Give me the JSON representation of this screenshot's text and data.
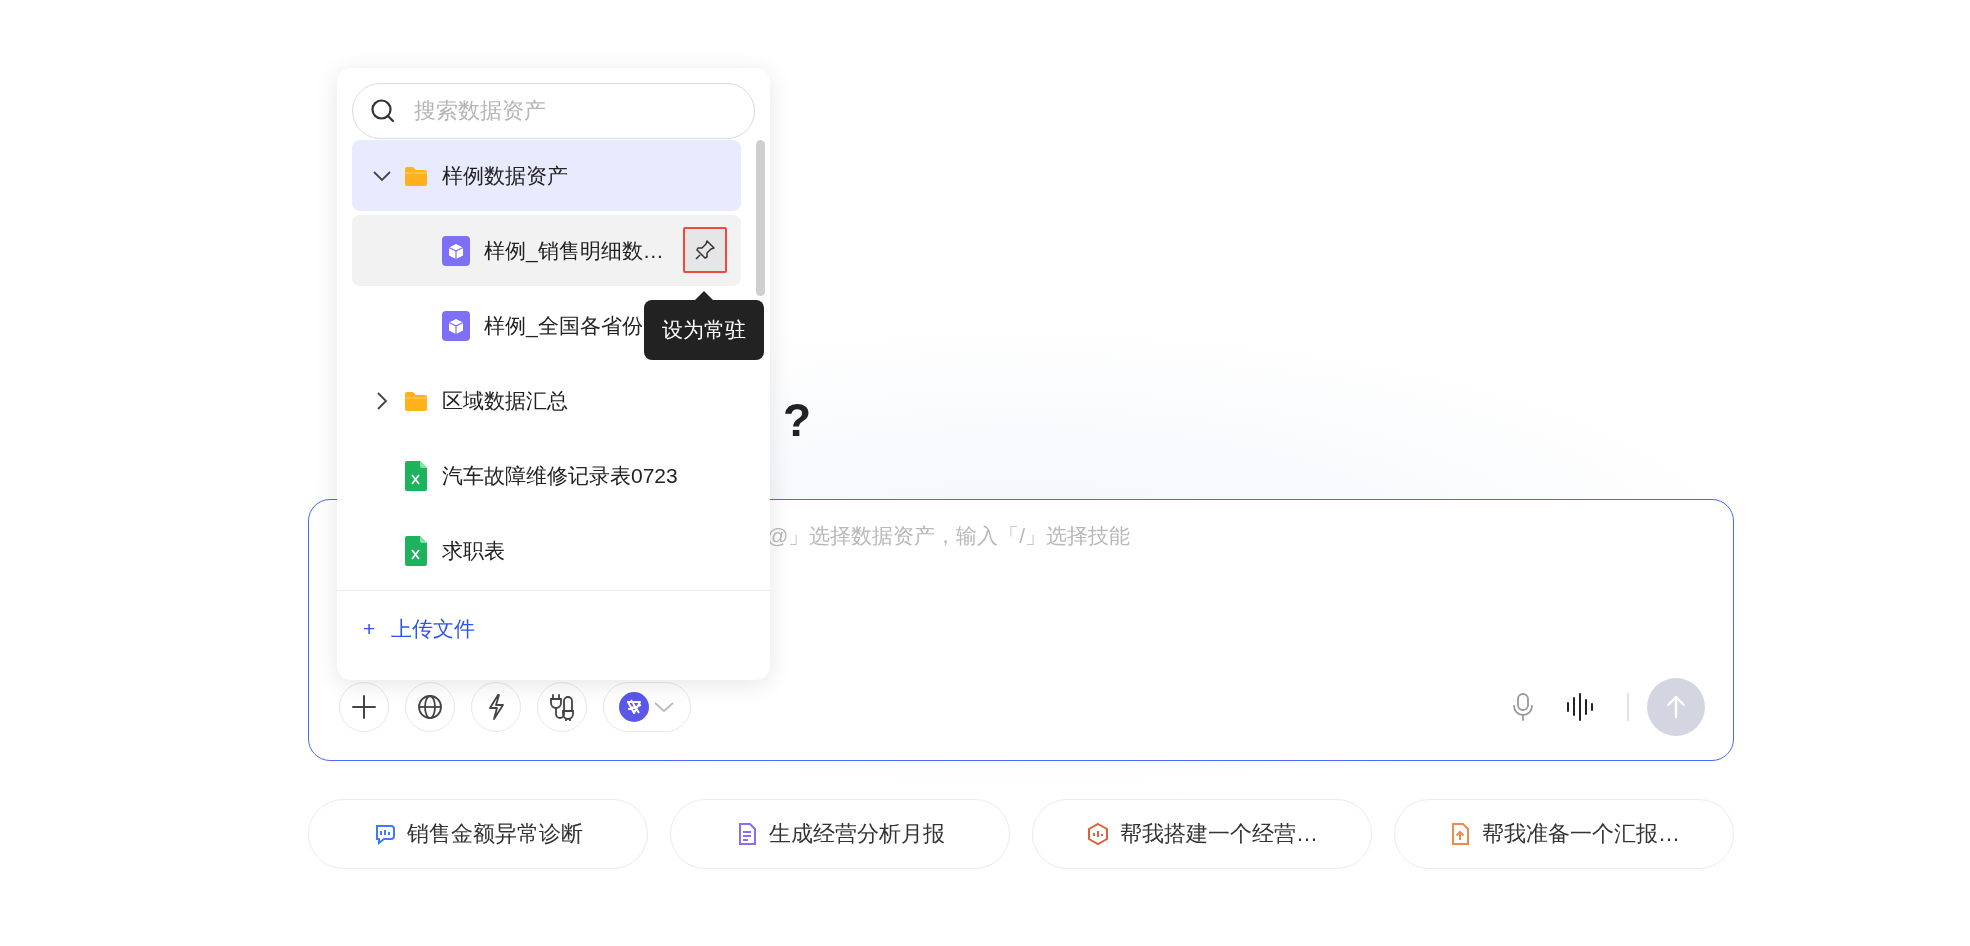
{
  "heading": {
    "line_2_end": "?"
  },
  "prompt_box": {
    "placeholder": "@」选择数据资产，输入「/」选择技能",
    "send_disabled": true
  },
  "suggestions": [
    {
      "label": "销售金额异常诊断",
      "color": "#3d7bf7"
    },
    {
      "label": "生成经营分析月报",
      "color": "#8c6cf2"
    },
    {
      "label": "帮我搭建一个经营…",
      "color": "#e0603a"
    },
    {
      "label": "帮我准备一个汇报…",
      "color": "#f08a4b"
    }
  ],
  "asset_menu": {
    "search": {
      "placeholder": "搜索数据资产"
    },
    "tree": [
      {
        "kind": "folder",
        "label": "样例数据资产",
        "expanded": true,
        "selected": true,
        "hovered": false,
        "children": [
          {
            "kind": "table",
            "label": "样例_销售明细数…",
            "selected": false,
            "hovered": true
          },
          {
            "kind": "table",
            "label": "样例_全国各省份",
            "selected": false,
            "hovered": false
          }
        ]
      },
      {
        "kind": "folder",
        "label": "区域数据汇总",
        "expanded": false,
        "selected": false,
        "hovered": false
      },
      {
        "kind": "sheet",
        "label": "汽车故障维修记录表0723",
        "selected": false,
        "hovered": false
      },
      {
        "kind": "sheet",
        "label": "求职表",
        "selected": false,
        "hovered": false
      }
    ],
    "tooltip": {
      "text": "设为常驻"
    },
    "upload": {
      "icon": "+",
      "label": "上传文件"
    }
  }
}
